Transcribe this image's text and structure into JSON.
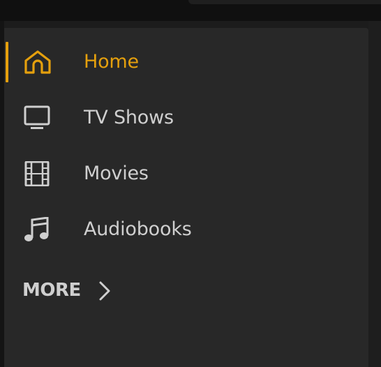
{
  "colors": {
    "accent": "#e5a00d",
    "text": "#cfcfcf",
    "sidebar_bg": "#282828",
    "background": "#1c1c1c"
  },
  "sidebar": {
    "items": [
      {
        "label": "Home",
        "icon": "home-icon",
        "active": true
      },
      {
        "label": "TV Shows",
        "icon": "tv-icon",
        "active": false
      },
      {
        "label": "Movies",
        "icon": "film-icon",
        "active": false
      },
      {
        "label": "Audiobooks",
        "icon": "music-note-icon",
        "active": false
      }
    ],
    "more": {
      "label": "MORE",
      "icon": "chevron-right-icon"
    }
  }
}
